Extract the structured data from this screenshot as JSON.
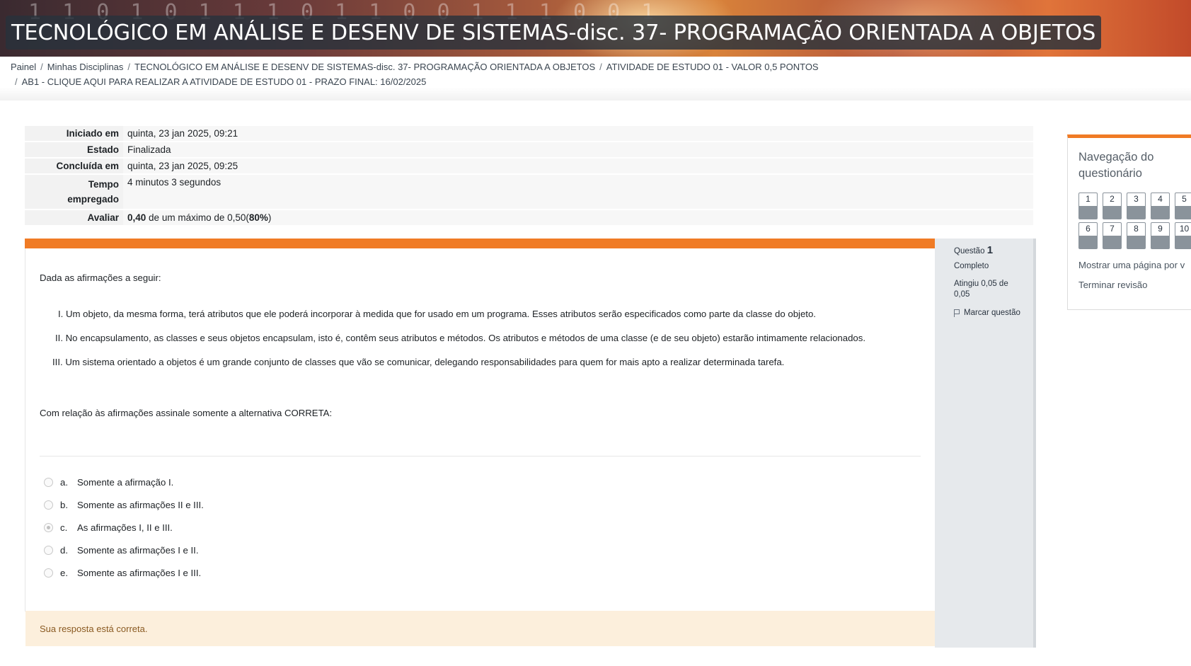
{
  "header": {
    "title": "TECNOLÓGICO EM ANÁLISE E DESENV DE SISTEMAS-disc. 37- PROGRAMAÇÃO ORIENTADA A OBJETOS"
  },
  "breadcrumb": {
    "items": [
      "Painel",
      "Minhas Disciplinas",
      "TECNOLÓGICO EM ANÁLISE E DESENV DE SISTEMAS-disc. 37- PROGRAMAÇÃO ORIENTADA A OBJETOS",
      "ATIVIDADE DE ESTUDO 01 - VALOR 0,5 PONTOS",
      "AB1 - CLIQUE AQUI PARA REALIZAR A ATIVIDADE DE ESTUDO 01 - PRAZO FINAL: 16/02/2025"
    ],
    "separator": "/"
  },
  "summary": {
    "started_label": "Iniciado em",
    "started_value": "quinta, 23 jan 2025, 09:21",
    "state_label": "Estado",
    "state_value": "Finalizada",
    "completed_label": "Concluída em",
    "completed_value": "quinta, 23 jan 2025, 09:25",
    "time_label_1": "Tempo",
    "time_label_2": "empregado",
    "time_value": "4 minutos 3 segundos",
    "grade_label": "Avaliar",
    "grade_score": "0,40",
    "grade_mid": "de um máximo de 0,50(",
    "grade_percent": "80%",
    "grade_end": ")"
  },
  "question": {
    "label": "Questão",
    "number": "1",
    "state": "Completo",
    "grade": "Atingiu 0,05 de 0,05",
    "flag_label": "Marcar questão",
    "intro": "Dada as afirmações a seguir:",
    "statements": [
      "I. Um objeto, da mesma forma, terá atributos que ele poderá incorporar à medida que for usado em um programa. Esses atributos serão especificados como parte da classe do objeto.",
      "II. No encapsulamento, as classes e seus objetos encapsulam, isto é, contêm seus atributos e métodos. Os atributos e métodos de uma classe (e de seu objeto) estarão intimamente relacionados.",
      "III. Um sistema orientado a objetos é um grande conjunto de classes que vão se comunicar, delegando responsabilidades para quem for mais apto a realizar determinada tarefa."
    ],
    "instruction": "Com relação às afirmações assinale somente a alternativa CORRETA:",
    "options": [
      {
        "letter": "a.",
        "text": "Somente a afirmação I.",
        "selected": false
      },
      {
        "letter": "b.",
        "text": "Somente as afirmações II e III.",
        "selected": false
      },
      {
        "letter": "c.",
        "text": "As afirmações I, II e III.",
        "selected": true
      },
      {
        "letter": "d.",
        "text": "Somente as afirmações I e II.",
        "selected": false
      },
      {
        "letter": "e.",
        "text": "Somente as afirmações I e III.",
        "selected": false
      }
    ],
    "feedback": "Sua resposta está correta."
  },
  "navigation": {
    "title_line1": "Navegação do",
    "title_line2": "questionário",
    "buttons": [
      "1",
      "2",
      "3",
      "4",
      "5",
      "6",
      "7",
      "8",
      "9",
      "10"
    ],
    "show_one_page": "Mostrar uma página por v",
    "finish_review": "Terminar revisão"
  },
  "colors": {
    "accent": "#f07b25",
    "feedback_bg": "#fcefdc",
    "info_bg": "#e6e9ec"
  }
}
